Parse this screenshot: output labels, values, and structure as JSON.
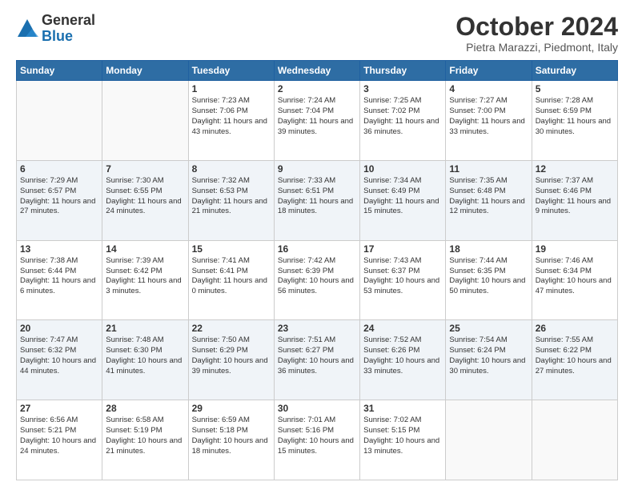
{
  "header": {
    "logo_line1": "General",
    "logo_line2": "Blue",
    "title": "October 2024",
    "subtitle": "Pietra Marazzi, Piedmont, Italy"
  },
  "days_of_week": [
    "Sunday",
    "Monday",
    "Tuesday",
    "Wednesday",
    "Thursday",
    "Friday",
    "Saturday"
  ],
  "weeks": [
    [
      {
        "day": "",
        "info": ""
      },
      {
        "day": "",
        "info": ""
      },
      {
        "day": "1",
        "info": "Sunrise: 7:23 AM\nSunset: 7:06 PM\nDaylight: 11 hours and 43 minutes."
      },
      {
        "day": "2",
        "info": "Sunrise: 7:24 AM\nSunset: 7:04 PM\nDaylight: 11 hours and 39 minutes."
      },
      {
        "day": "3",
        "info": "Sunrise: 7:25 AM\nSunset: 7:02 PM\nDaylight: 11 hours and 36 minutes."
      },
      {
        "day": "4",
        "info": "Sunrise: 7:27 AM\nSunset: 7:00 PM\nDaylight: 11 hours and 33 minutes."
      },
      {
        "day": "5",
        "info": "Sunrise: 7:28 AM\nSunset: 6:59 PM\nDaylight: 11 hours and 30 minutes."
      }
    ],
    [
      {
        "day": "6",
        "info": "Sunrise: 7:29 AM\nSunset: 6:57 PM\nDaylight: 11 hours and 27 minutes."
      },
      {
        "day": "7",
        "info": "Sunrise: 7:30 AM\nSunset: 6:55 PM\nDaylight: 11 hours and 24 minutes."
      },
      {
        "day": "8",
        "info": "Sunrise: 7:32 AM\nSunset: 6:53 PM\nDaylight: 11 hours and 21 minutes."
      },
      {
        "day": "9",
        "info": "Sunrise: 7:33 AM\nSunset: 6:51 PM\nDaylight: 11 hours and 18 minutes."
      },
      {
        "day": "10",
        "info": "Sunrise: 7:34 AM\nSunset: 6:49 PM\nDaylight: 11 hours and 15 minutes."
      },
      {
        "day": "11",
        "info": "Sunrise: 7:35 AM\nSunset: 6:48 PM\nDaylight: 11 hours and 12 minutes."
      },
      {
        "day": "12",
        "info": "Sunrise: 7:37 AM\nSunset: 6:46 PM\nDaylight: 11 hours and 9 minutes."
      }
    ],
    [
      {
        "day": "13",
        "info": "Sunrise: 7:38 AM\nSunset: 6:44 PM\nDaylight: 11 hours and 6 minutes."
      },
      {
        "day": "14",
        "info": "Sunrise: 7:39 AM\nSunset: 6:42 PM\nDaylight: 11 hours and 3 minutes."
      },
      {
        "day": "15",
        "info": "Sunrise: 7:41 AM\nSunset: 6:41 PM\nDaylight: 11 hours and 0 minutes."
      },
      {
        "day": "16",
        "info": "Sunrise: 7:42 AM\nSunset: 6:39 PM\nDaylight: 10 hours and 56 minutes."
      },
      {
        "day": "17",
        "info": "Sunrise: 7:43 AM\nSunset: 6:37 PM\nDaylight: 10 hours and 53 minutes."
      },
      {
        "day": "18",
        "info": "Sunrise: 7:44 AM\nSunset: 6:35 PM\nDaylight: 10 hours and 50 minutes."
      },
      {
        "day": "19",
        "info": "Sunrise: 7:46 AM\nSunset: 6:34 PM\nDaylight: 10 hours and 47 minutes."
      }
    ],
    [
      {
        "day": "20",
        "info": "Sunrise: 7:47 AM\nSunset: 6:32 PM\nDaylight: 10 hours and 44 minutes."
      },
      {
        "day": "21",
        "info": "Sunrise: 7:48 AM\nSunset: 6:30 PM\nDaylight: 10 hours and 41 minutes."
      },
      {
        "day": "22",
        "info": "Sunrise: 7:50 AM\nSunset: 6:29 PM\nDaylight: 10 hours and 39 minutes."
      },
      {
        "day": "23",
        "info": "Sunrise: 7:51 AM\nSunset: 6:27 PM\nDaylight: 10 hours and 36 minutes."
      },
      {
        "day": "24",
        "info": "Sunrise: 7:52 AM\nSunset: 6:26 PM\nDaylight: 10 hours and 33 minutes."
      },
      {
        "day": "25",
        "info": "Sunrise: 7:54 AM\nSunset: 6:24 PM\nDaylight: 10 hours and 30 minutes."
      },
      {
        "day": "26",
        "info": "Sunrise: 7:55 AM\nSunset: 6:22 PM\nDaylight: 10 hours and 27 minutes."
      }
    ],
    [
      {
        "day": "27",
        "info": "Sunrise: 6:56 AM\nSunset: 5:21 PM\nDaylight: 10 hours and 24 minutes."
      },
      {
        "day": "28",
        "info": "Sunrise: 6:58 AM\nSunset: 5:19 PM\nDaylight: 10 hours and 21 minutes."
      },
      {
        "day": "29",
        "info": "Sunrise: 6:59 AM\nSunset: 5:18 PM\nDaylight: 10 hours and 18 minutes."
      },
      {
        "day": "30",
        "info": "Sunrise: 7:01 AM\nSunset: 5:16 PM\nDaylight: 10 hours and 15 minutes."
      },
      {
        "day": "31",
        "info": "Sunrise: 7:02 AM\nSunset: 5:15 PM\nDaylight: 10 hours and 13 minutes."
      },
      {
        "day": "",
        "info": ""
      },
      {
        "day": "",
        "info": ""
      }
    ]
  ]
}
